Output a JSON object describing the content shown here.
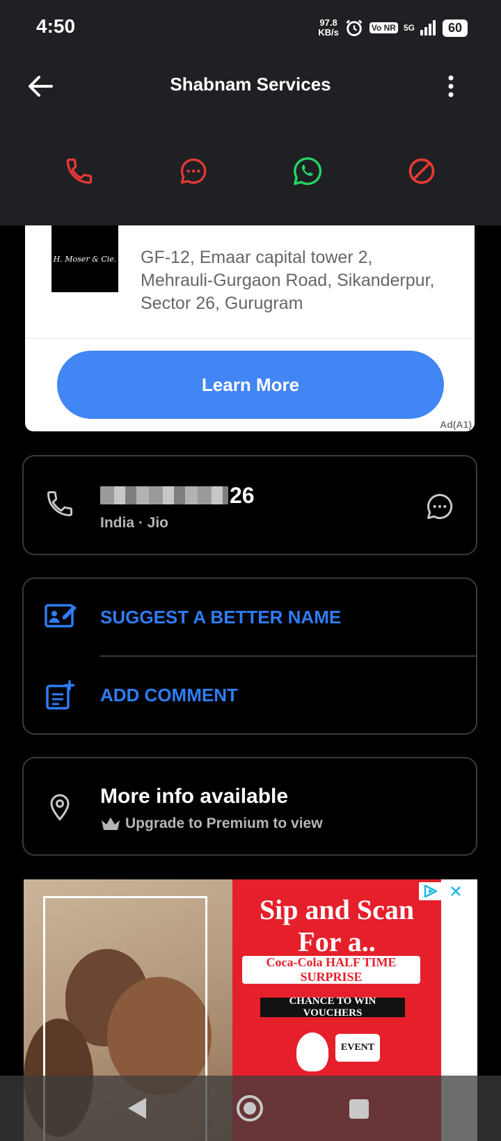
{
  "status_bar": {
    "time": "4:50",
    "net_speed_value": "97.8",
    "net_speed_unit": "KB/s",
    "volte_label": "Vo NR",
    "network_label": "5G",
    "battery_level": "60"
  },
  "header": {
    "title": "Shabnam Services"
  },
  "action_icons": [
    "phone-icon",
    "message-icon",
    "whatsapp-icon",
    "block-icon"
  ],
  "colors": {
    "red_accent": "#e53935",
    "whatsapp_green": "#25d366",
    "link_blue": "#2f7df6",
    "cta_blue": "#4285f4"
  },
  "ad": {
    "logo_text": "H. Moser & Cie.",
    "address": "GF-12, Emaar capital tower 2, Mehrauli-Gurgaon Road, Sikanderpur, Sector 26, Gurugram",
    "cta_label": "Learn More",
    "tag": "Ad(A1)"
  },
  "number_card": {
    "number_visible_suffix": "26",
    "subtitle": "India · Jio"
  },
  "actions": {
    "suggest_label": "SUGGEST A BETTER NAME",
    "comment_label": "ADD COMMENT"
  },
  "info": {
    "title": "More info available",
    "subtitle": "Upgrade to Premium to view"
  },
  "banner": {
    "headline_1": "Sip and Scan",
    "headline_2": "For a..",
    "promo": "Coca-Cola HALF TIME SURPRISE",
    "sub_promo": "CHANCE TO WIN VOUCHERS",
    "event": "EVENT"
  }
}
